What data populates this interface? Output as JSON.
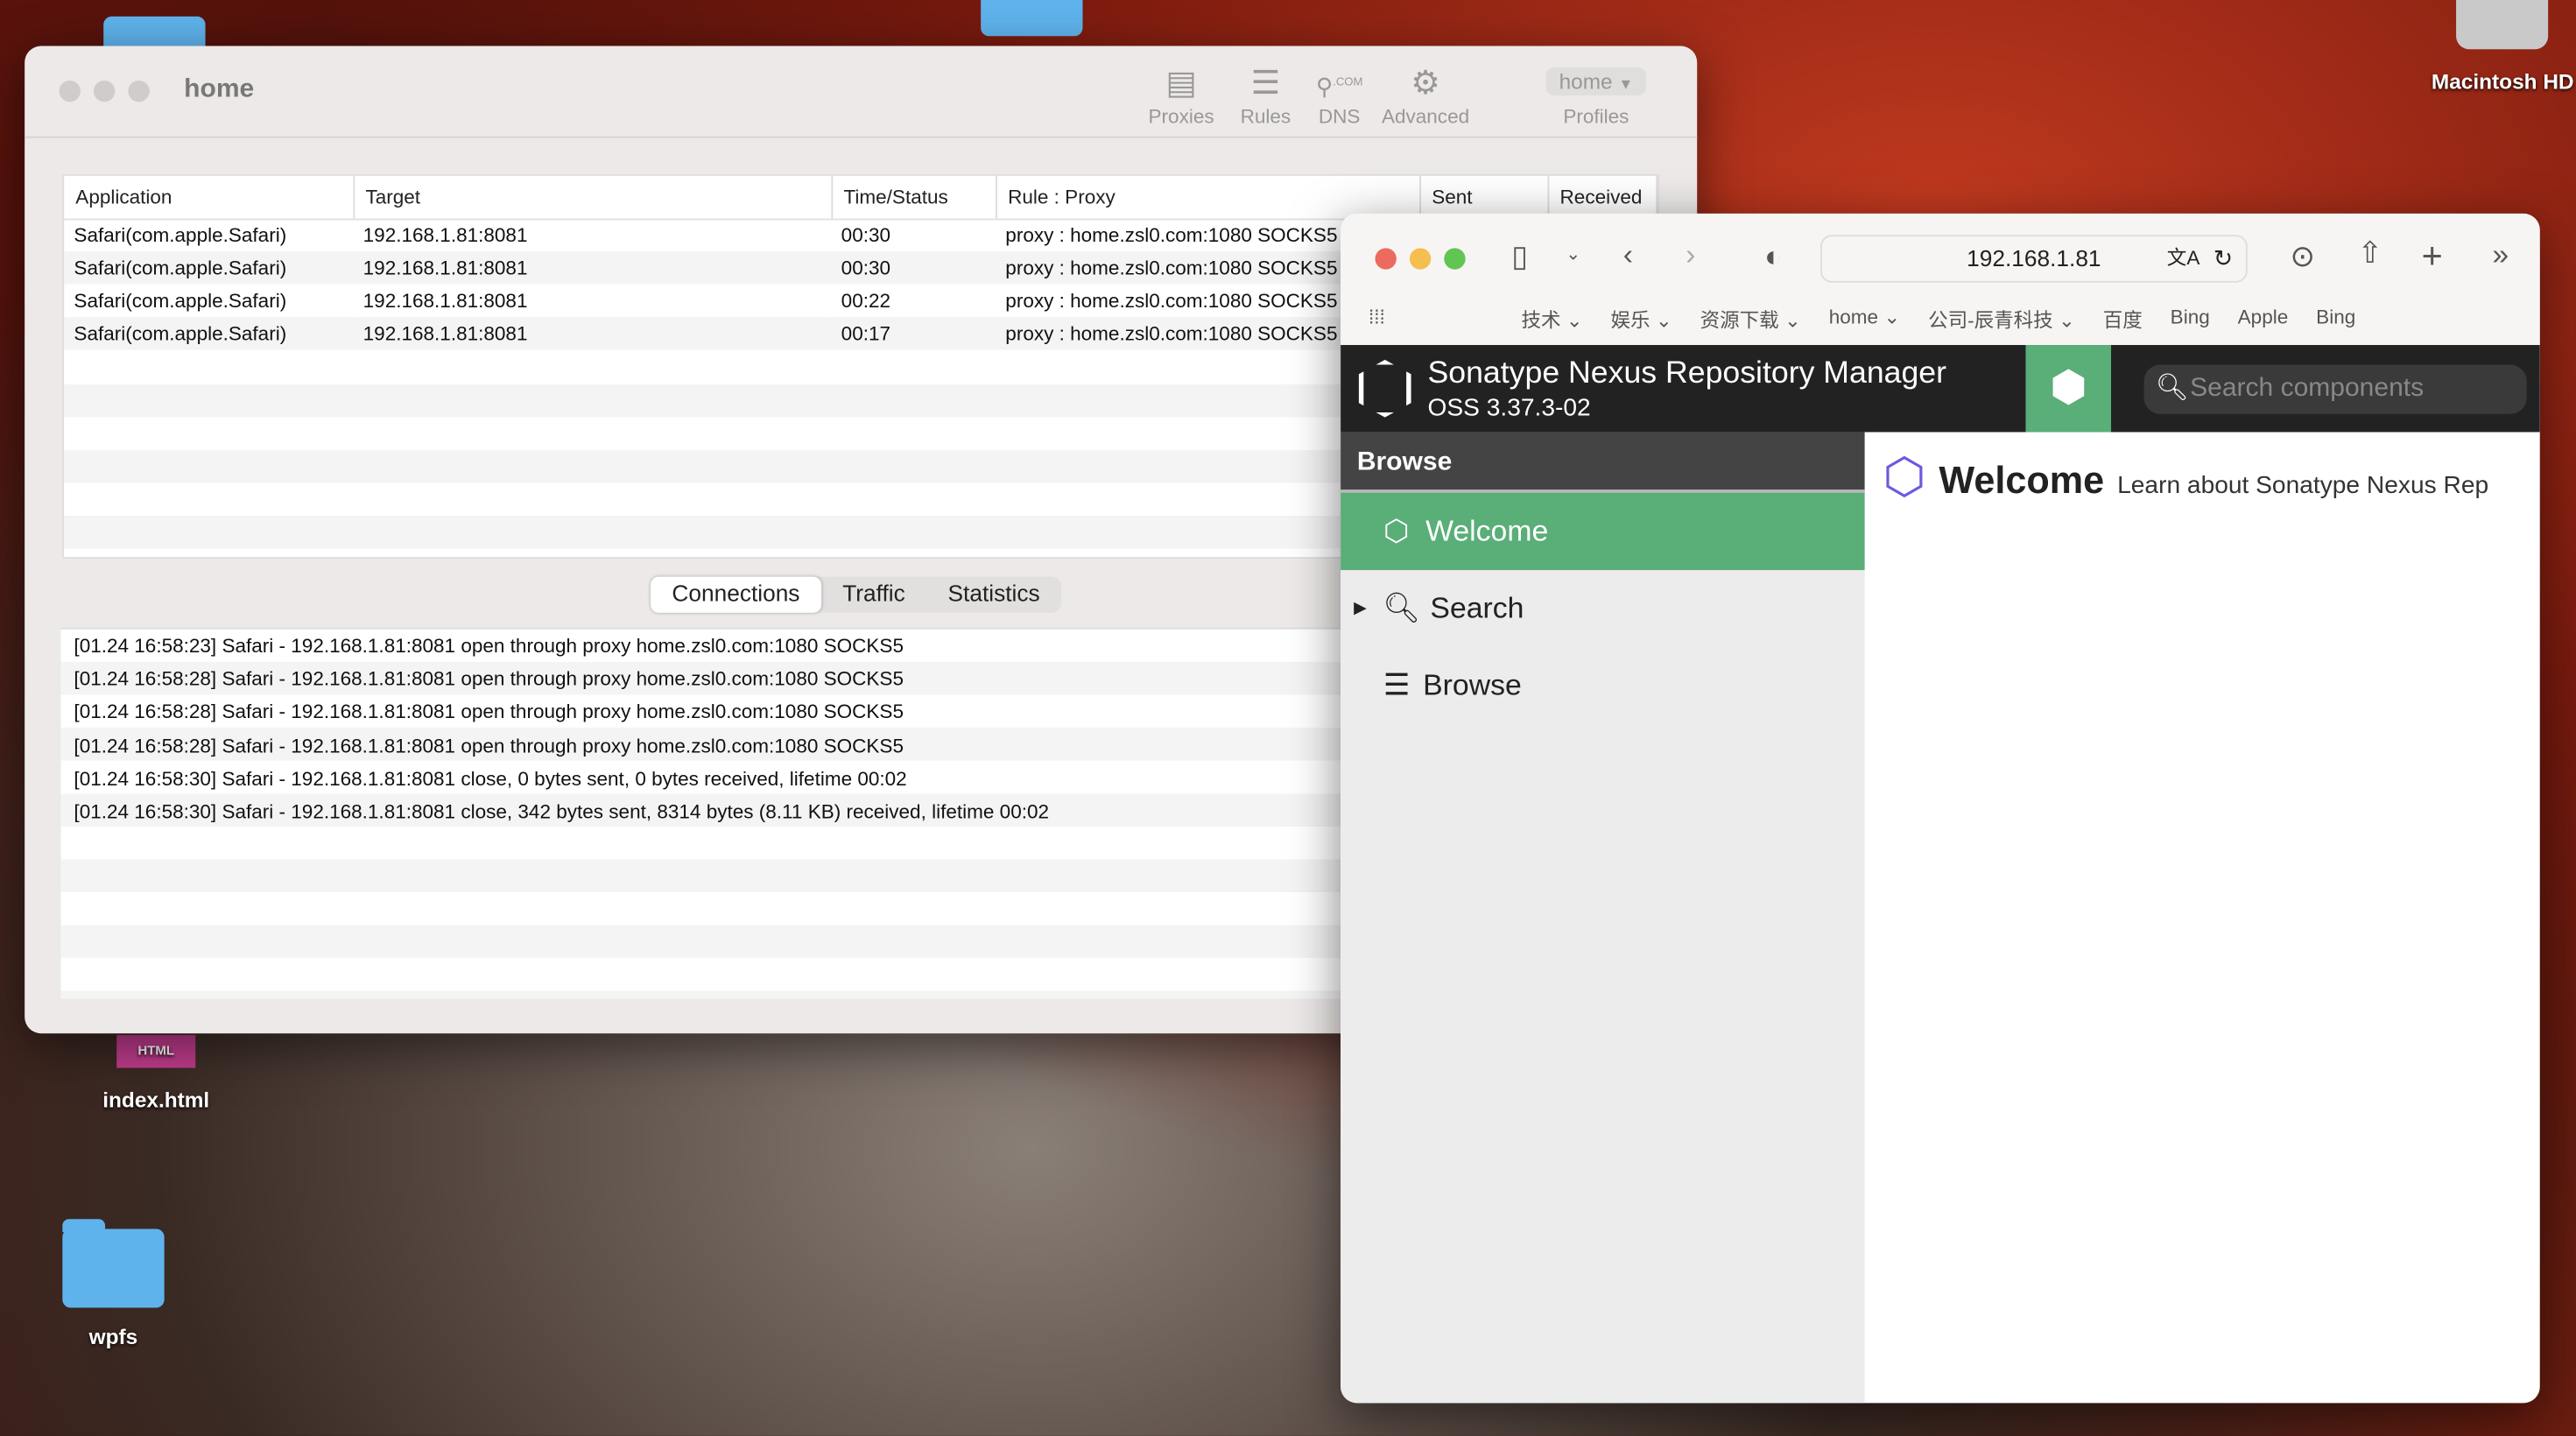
{
  "desktop": {
    "icons": [
      {
        "label": "Macintosh HD"
      },
      {
        "label": "index.html",
        "badge": "HTML"
      },
      {
        "label": "wpfs"
      }
    ]
  },
  "proxifier": {
    "title": "home",
    "toolbar": [
      {
        "label": "Proxies",
        "icon": "server-icon"
      },
      {
        "label": "Rules",
        "icon": "scroll-icon"
      },
      {
        "label": "DNS",
        "icon": "dns-search-icon",
        "badge": ".COM"
      },
      {
        "label": "Advanced",
        "icon": "gear-icon"
      }
    ],
    "profiles": {
      "selected": "home",
      "label": "Profiles"
    },
    "columns": [
      "Application",
      "Target",
      "Time/Status",
      "Rule : Proxy",
      "Sent",
      "Received"
    ],
    "rows": [
      [
        "Safari(com.apple.Safari)",
        "192.168.1.81:8081",
        "00:30",
        "proxy : home.zsl0.com:1080 SOCKS5",
        "",
        ""
      ],
      [
        "Safari(com.apple.Safari)",
        "192.168.1.81:8081",
        "00:30",
        "proxy : home.zsl0.com:1080 SOCKS5",
        "",
        ""
      ],
      [
        "Safari(com.apple.Safari)",
        "192.168.1.81:8081",
        "00:22",
        "proxy : home.zsl0.com:1080 SOCKS5",
        "",
        ""
      ],
      [
        "Safari(com.apple.Safari)",
        "192.168.1.81:8081",
        "00:17",
        "proxy : home.zsl0.com:1080 SOCKS5",
        "",
        ""
      ]
    ],
    "tabs": [
      "Connections",
      "Traffic",
      "Statistics"
    ],
    "active_tab": "Connections",
    "log": [
      "[01.24 16:58:23] Safari - 192.168.1.81:8081 open through proxy home.zsl0.com:1080 SOCKS5",
      "[01.24 16:58:28] Safari - 192.168.1.81:8081 open through proxy home.zsl0.com:1080 SOCKS5",
      "[01.24 16:58:28] Safari - 192.168.1.81:8081 open through proxy home.zsl0.com:1080 SOCKS5",
      "[01.24 16:58:28] Safari - 192.168.1.81:8081 open through proxy home.zsl0.com:1080 SOCKS5",
      "[01.24 16:58:30] Safari - 192.168.1.81:8081 close, 0 bytes sent, 0 bytes received, lifetime 00:02",
      "[01.24 16:58:30] Safari - 192.168.1.81:8081 close, 342 bytes sent, 8314 bytes (8.11 KB) received, lifetime 00:02"
    ]
  },
  "safari": {
    "address": "192.168.1.81",
    "bookmarks": [
      "技术",
      "娱乐",
      "资源下载",
      "home",
      "公司-辰青科技",
      "百度",
      "Bing",
      "Apple",
      "Bing"
    ],
    "bookmark_has_menu": [
      true,
      true,
      true,
      true,
      true,
      false,
      false,
      false,
      false
    ]
  },
  "nexus": {
    "title": "Sonatype Nexus Repository Manager",
    "version": "OSS 3.37.3-02",
    "search_placeholder": "Search components",
    "sidebar_header": "Browse",
    "sidebar": [
      "Welcome",
      "Search",
      "Browse"
    ],
    "active": "Welcome",
    "welcome_title": "Welcome",
    "welcome_sub": "Learn about Sonatype Nexus Rep",
    "colors": {
      "green": "#5aae78",
      "dark": "#222222"
    }
  }
}
